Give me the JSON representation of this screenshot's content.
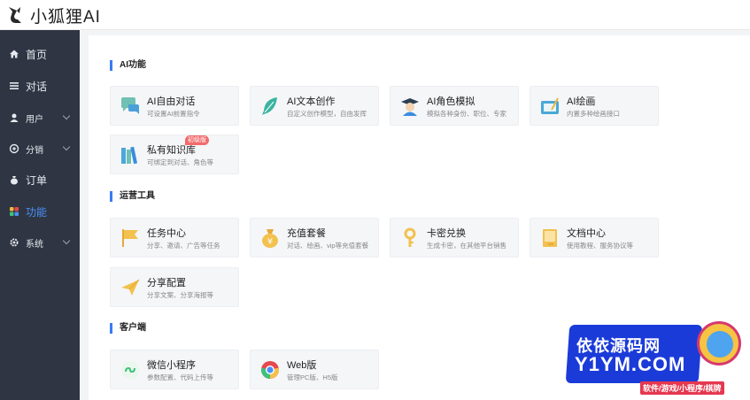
{
  "app": {
    "name": "小狐狸AI"
  },
  "sidebar": {
    "items": [
      {
        "label": "首页",
        "icon": "home-icon",
        "expandable": false,
        "active": false
      },
      {
        "label": "对话",
        "icon": "list-icon",
        "expandable": false,
        "active": false
      },
      {
        "label": "用户",
        "icon": "user-icon",
        "expandable": true,
        "active": false
      },
      {
        "label": "分销",
        "icon": "share-icon",
        "expandable": true,
        "active": false
      },
      {
        "label": "订单",
        "icon": "money-bag-icon",
        "expandable": false,
        "active": false
      },
      {
        "label": "功能",
        "icon": "grid-icon",
        "expandable": false,
        "active": true
      },
      {
        "label": "系统",
        "icon": "gear-icon",
        "expandable": true,
        "active": false
      }
    ],
    "active_color": "#4a8ff7"
  },
  "sections": [
    {
      "title": "AI功能",
      "cards": [
        {
          "title": "AI自由对话",
          "desc": "可设置AI前置指令",
          "icon": "chat-bubble-icon"
        },
        {
          "title": "AI文本创作",
          "desc": "自定义创作模型，自由发挥",
          "icon": "feather-icon"
        },
        {
          "title": "AI角色模拟",
          "desc": "模拟各种身份、职位、专家",
          "icon": "graduate-icon"
        },
        {
          "title": "AI绘画",
          "desc": "内置多种绘画接口",
          "icon": "paint-board-icon"
        },
        {
          "title": "私有知识库",
          "desc": "可绑定到对话、角色等",
          "icon": "books-icon",
          "tag": "初级版"
        }
      ]
    },
    {
      "title": "运营工具",
      "cards": [
        {
          "title": "任务中心",
          "desc": "分享、邀请、广告等任务",
          "icon": "flag-icon"
        },
        {
          "title": "充值套餐",
          "desc": "对话、绘画、vip等充值套餐",
          "icon": "money-bag-icon"
        },
        {
          "title": "卡密兑换",
          "desc": "生成卡密，在其他平台销售",
          "icon": "key-icon"
        },
        {
          "title": "文档中心",
          "desc": "使用教程、服务协议等",
          "icon": "document-icon"
        },
        {
          "title": "分享配置",
          "desc": "分享文案、分享海报等",
          "icon": "paper-plane-icon"
        }
      ]
    },
    {
      "title": "客户端",
      "cards": [
        {
          "title": "微信小程序",
          "desc": "参数配置、代码上传等",
          "icon": "mini-program-icon"
        },
        {
          "title": "Web版",
          "desc": "管理PC版、H5版",
          "icon": "chrome-icon"
        }
      ]
    }
  ],
  "watermark": {
    "line1": "依依源码网",
    "line2": "Y1YM.COM",
    "line3": "软件/游戏/小程序/棋牌"
  }
}
